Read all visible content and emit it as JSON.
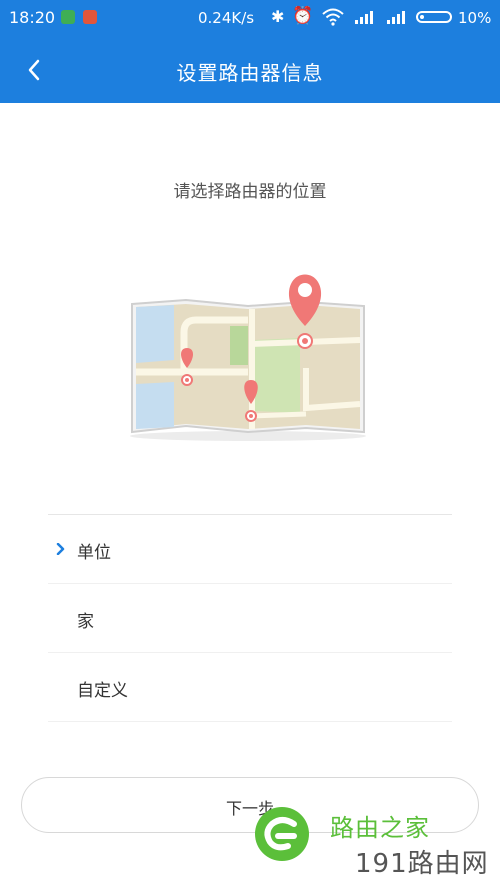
{
  "status_bar": {
    "time": "18:20",
    "net_speed": "0.24K/s",
    "bluetooth_icon": "bluetooth-icon",
    "alarm_icon": "alarm-icon",
    "battery_percent": "10%"
  },
  "header": {
    "title": "设置路由器信息",
    "back_icon": "chevron-left-icon"
  },
  "main": {
    "prompt": "请选择路由器的位置",
    "illustration": "map-pins-illustration",
    "options": [
      {
        "label": "单位",
        "selected": true
      },
      {
        "label": "家",
        "selected": false
      },
      {
        "label": "自定义",
        "selected": false
      }
    ],
    "next_label": "下一步"
  },
  "watermark": {
    "line1": "路由之家",
    "line2": "191路由网"
  },
  "colors": {
    "primary": "#1d7fde",
    "pin": "#f07876",
    "watermark_green": "#5bbf3a"
  }
}
